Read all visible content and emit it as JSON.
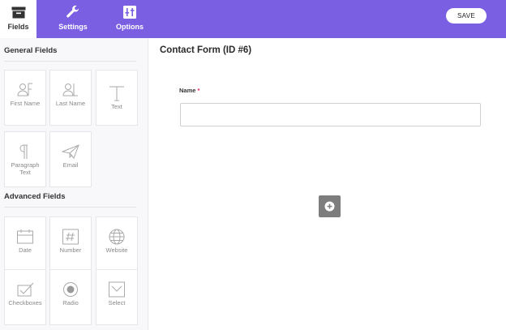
{
  "tabs": [
    {
      "label": "Fields",
      "icon": "archive-icon"
    },
    {
      "label": "Settings",
      "icon": "wrench-icon"
    },
    {
      "label": "Options",
      "icon": "sliders-icon"
    }
  ],
  "toolbar": {
    "save_label": "SAVE"
  },
  "sidebar": {
    "general_title": "General Fields",
    "advanced_title": "Advanced Fields",
    "general_fields": [
      {
        "label": "First Name",
        "icon": "first-name-icon"
      },
      {
        "label": "Last Name",
        "icon": "last-name-icon"
      },
      {
        "label": "Text",
        "icon": "text-icon"
      },
      {
        "label": "Paragraph Text",
        "icon": "paragraph-icon"
      },
      {
        "label": "Email",
        "icon": "paper-plane-icon"
      }
    ],
    "advanced_fields": [
      {
        "label": "Date",
        "icon": "calendar-icon"
      },
      {
        "label": "Number",
        "icon": "hash-icon"
      },
      {
        "label": "Website",
        "icon": "globe-icon"
      },
      {
        "label": "Checkboxes",
        "icon": "checkbox-icon"
      },
      {
        "label": "Radio",
        "icon": "radio-icon"
      },
      {
        "label": "Select",
        "icon": "dropdown-icon"
      }
    ]
  },
  "main": {
    "title": "Contact Form (ID #6)",
    "field_label": "Name",
    "required_mark": "*"
  },
  "colors": {
    "accent": "#7b5fe3",
    "required": "#e0245e"
  }
}
